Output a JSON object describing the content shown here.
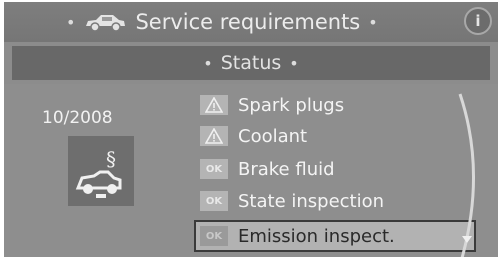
{
  "header": {
    "title": "Service requirements",
    "separator": "•",
    "car_icon": "car-icon",
    "info_icon": "info-icon",
    "info_symbol": "i"
  },
  "status": {
    "label": "Status",
    "separator": "•"
  },
  "main": {
    "date": "10/2008",
    "service_icon": "vehicle-inspection-icon",
    "service_icon_symbol": "§",
    "items": [
      {
        "label": "Spark plugs",
        "status": "warning",
        "badge": "warning-triangle-icon"
      },
      {
        "label": "Coolant",
        "status": "warning",
        "badge": "warning-triangle-icon"
      },
      {
        "label": "Brake fluid",
        "status": "ok",
        "badge": "OK"
      },
      {
        "label": "State inspection",
        "status": "ok",
        "badge": "OK"
      },
      {
        "label": "Emission inspect.",
        "status": "ok",
        "badge": "OK",
        "selected": true
      }
    ],
    "scroll_icon": "chevron-down-icon"
  },
  "colors": {
    "background": "#8c8c8c",
    "title_bar": "#7a7a7a",
    "status_bar": "#686868",
    "text": "#f4f4f4",
    "selected_row": "#b2b2b2"
  }
}
